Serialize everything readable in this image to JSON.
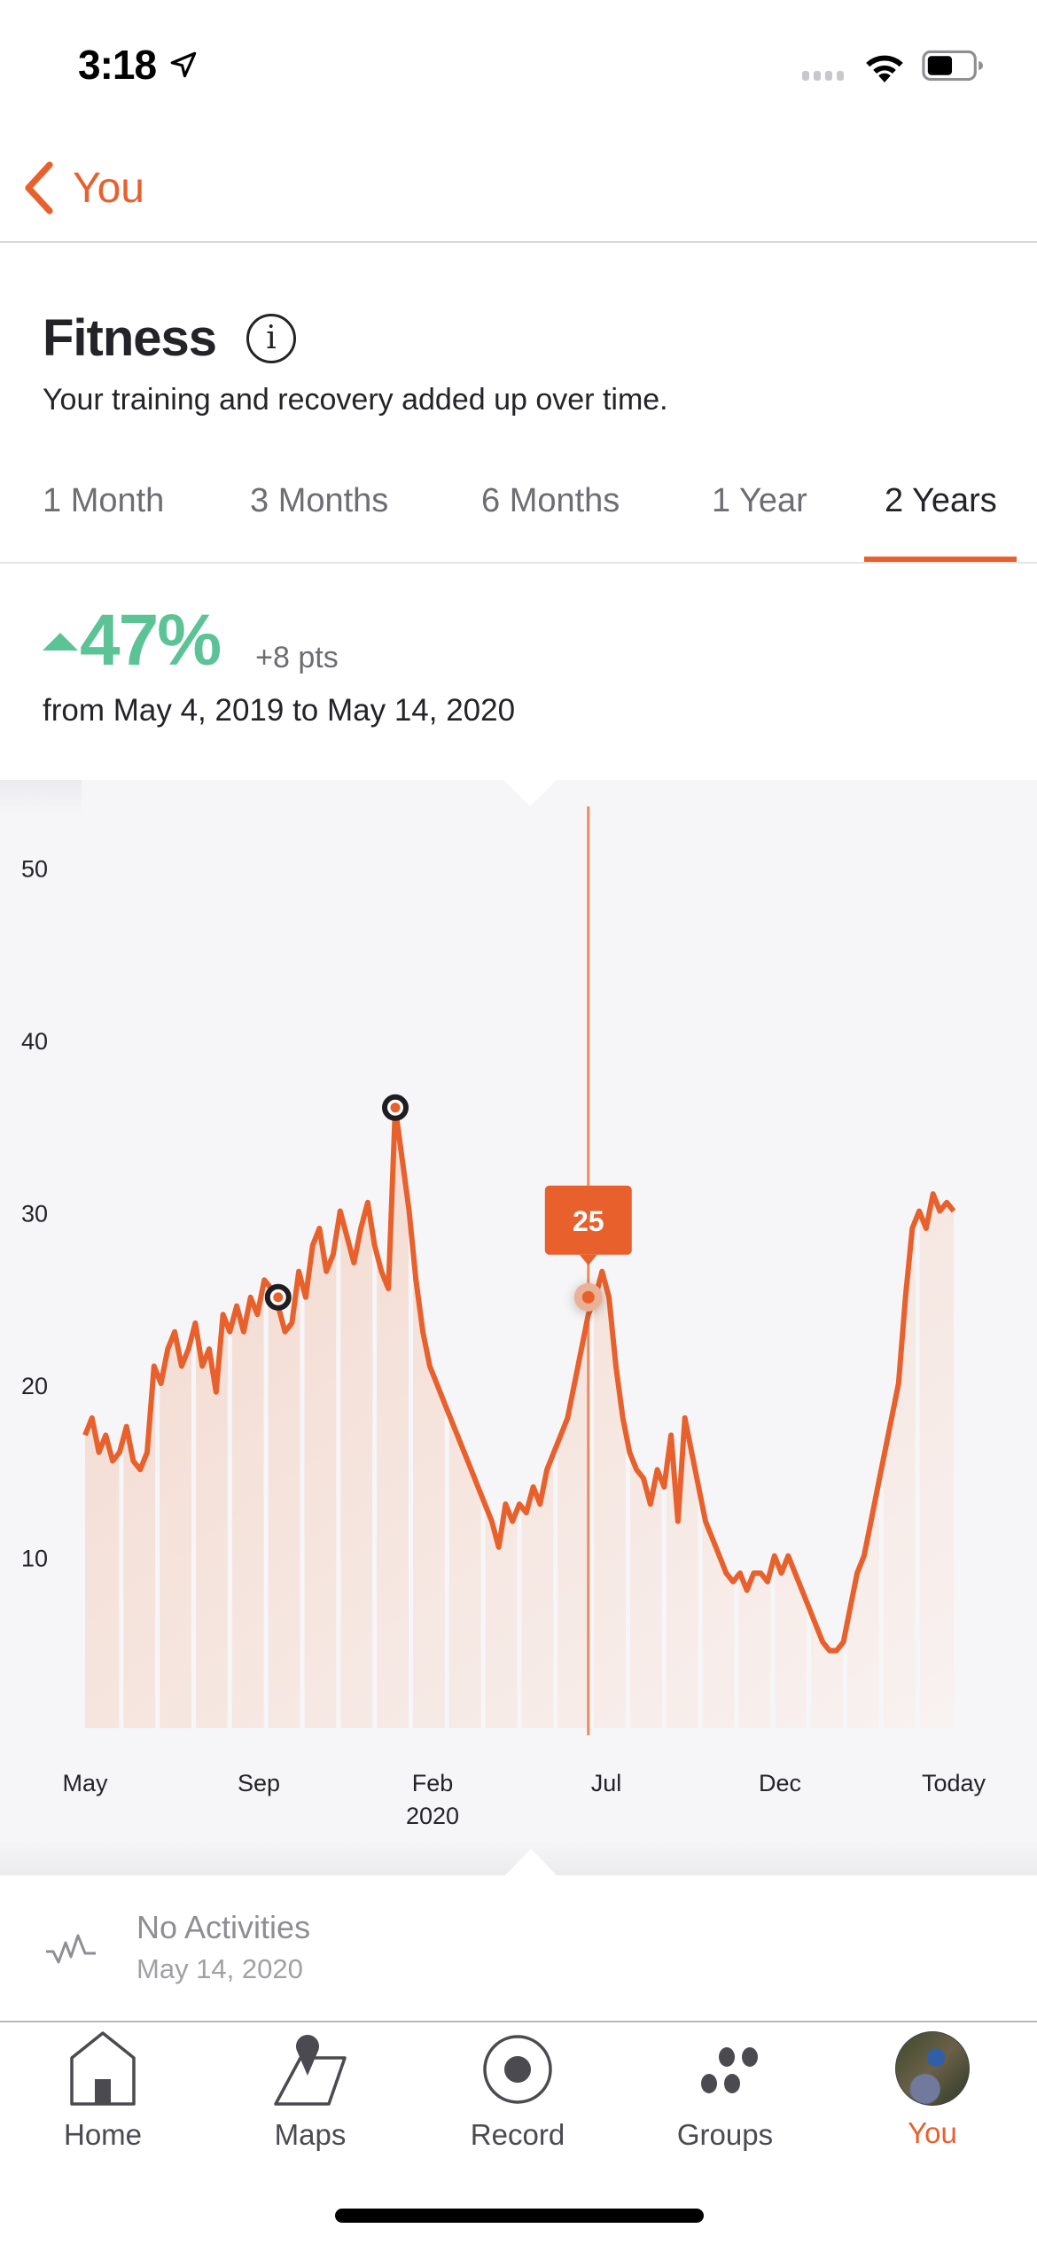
{
  "status_bar": {
    "time": "3:18",
    "location_icon": "location-arrow-icon",
    "wifi_icon": "wifi-icon",
    "battery_icon": "battery-icon",
    "battery_level": 0.55
  },
  "nav": {
    "back_label": "You",
    "back_icon": "chevron-left-icon"
  },
  "header": {
    "title": "Fitness",
    "info_icon_glyph": "i",
    "subtitle": "Your training and recovery added up over time."
  },
  "tabs": [
    {
      "label": "1 Month",
      "active": false
    },
    {
      "label": "3 Months",
      "active": false
    },
    {
      "label": "6 Months",
      "active": false
    },
    {
      "label": "1 Year",
      "active": false
    },
    {
      "label": "2 Years",
      "active": true
    }
  ],
  "summary": {
    "change_percent": "47%",
    "change_direction": "up",
    "change_points": "+8 pts",
    "range": "from May 4, 2019 to May 14, 2020"
  },
  "colors": {
    "accent": "#e8602c",
    "positive": "#5cc397",
    "text_primary": "#242428",
    "text_secondary": "#6d6d72",
    "chart_bg": "#f6f6f8"
  },
  "chart_data": {
    "type": "area",
    "title": "Fitness",
    "xlabel": "",
    "ylabel": "",
    "ylim": [
      0,
      52
    ],
    "yticks": [
      10,
      20,
      30,
      40,
      50
    ],
    "grid": false,
    "xtick_labels": [
      {
        "label": "May",
        "sublabel": "",
        "pos": 0.0
      },
      {
        "label": "Sep",
        "sublabel": "",
        "pos": 0.2
      },
      {
        "label": "Feb",
        "sublabel": "2020",
        "pos": 0.4
      },
      {
        "label": "Jul",
        "sublabel": "",
        "pos": 0.6
      },
      {
        "label": "Dec",
        "sublabel": "",
        "pos": 0.8
      },
      {
        "label": "Today",
        "sublabel": "",
        "pos": 1.0
      }
    ],
    "series": [
      {
        "name": "Fitness",
        "values": [
          17,
          18,
          16,
          17,
          15.5,
          16,
          17.5,
          15.5,
          15,
          16,
          21,
          20,
          22,
          23,
          21,
          22,
          23.5,
          21,
          22,
          19.5,
          24,
          23,
          24.5,
          23,
          25,
          24,
          26,
          25.5,
          24.5,
          23,
          23.5,
          26.5,
          25,
          28,
          29,
          26.5,
          27.5,
          30,
          28.5,
          27,
          29,
          30.5,
          28,
          26.5,
          25.5,
          36,
          33,
          30,
          26,
          23,
          21,
          20,
          19,
          18,
          17,
          16,
          15,
          14,
          13,
          12,
          10.5,
          13,
          12,
          13,
          12.5,
          14,
          13,
          15,
          16,
          17,
          18,
          20,
          22,
          24,
          25,
          26.5,
          25,
          21,
          18,
          16,
          15,
          14.5,
          13,
          15,
          14,
          17,
          12,
          18,
          16,
          14,
          12,
          11,
          10,
          9,
          8.5,
          9,
          8,
          9,
          9,
          8.5,
          10,
          9,
          10,
          9,
          8,
          7,
          6,
          5,
          4.5,
          4.5,
          5,
          7,
          9,
          10,
          12,
          14,
          16,
          18,
          20,
          25,
          29,
          30,
          29,
          31,
          30,
          30.5,
          30
        ]
      }
    ],
    "annotations": [
      {
        "type": "marker",
        "label": "best-effort-marker",
        "index": 28,
        "value": 25
      },
      {
        "type": "marker",
        "label": "peak-marker",
        "index": 45,
        "value": 36
      }
    ],
    "selected": {
      "index": 73,
      "value": 25,
      "tooltip": "25",
      "date": "May 14, 2020"
    },
    "weekly_bands": 24
  },
  "activity": {
    "title": "No Activities",
    "date": "May 14, 2020",
    "icon": "activity-pulse-icon"
  },
  "tab_bar": {
    "items": [
      {
        "label": "Home",
        "icon": "home-icon",
        "active": false
      },
      {
        "label": "Maps",
        "icon": "map-pin-icon",
        "active": false
      },
      {
        "label": "Record",
        "icon": "record-icon",
        "active": false
      },
      {
        "label": "Groups",
        "icon": "groups-icon",
        "active": false
      },
      {
        "label": "You",
        "icon": "avatar",
        "active": true
      }
    ]
  }
}
